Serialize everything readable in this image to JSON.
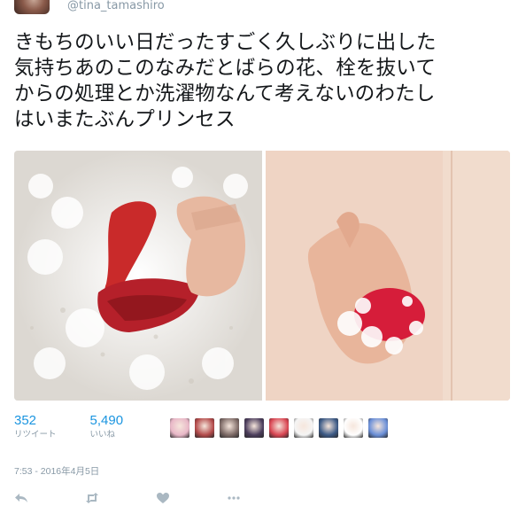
{
  "tweet": {
    "handle": "@tina_tamashiro",
    "text_lines": [
      "きもちのいい日だったすごく久しぶりに出した",
      "気持ちあのこのなみだとばらの花、栓を抜いて",
      "からの処理とか洗濯物なんて考えないのわたし",
      "はいまたぶんプリンセス"
    ],
    "media": [
      {
        "alt": "red shoe and hand in bath foam"
      },
      {
        "alt": "hand holding red object in bath foam"
      }
    ],
    "retweets": {
      "count": "352",
      "label": "リツイート"
    },
    "likes": {
      "count": "5,490",
      "label": "いいね"
    },
    "liker_avatars": [
      {
        "color": "#e8b7c7"
      },
      {
        "color": "#b34a4a"
      },
      {
        "color": "#7d6a66"
      },
      {
        "color": "#4b3d5c"
      },
      {
        "color": "#d94552"
      },
      {
        "color": "#f5f5f5"
      },
      {
        "color": "#3c5a86"
      },
      {
        "color": "#ffffff"
      },
      {
        "color": "#6a8fd8"
      }
    ],
    "timestamp": "7:53 - 2016年4月5日"
  },
  "actions": [
    "reply-icon",
    "retweet-icon",
    "like-icon",
    "more-icon"
  ],
  "colors": {
    "accent": "#1b95e0",
    "muted": "#8899a6",
    "icon": "#aab8c2"
  }
}
